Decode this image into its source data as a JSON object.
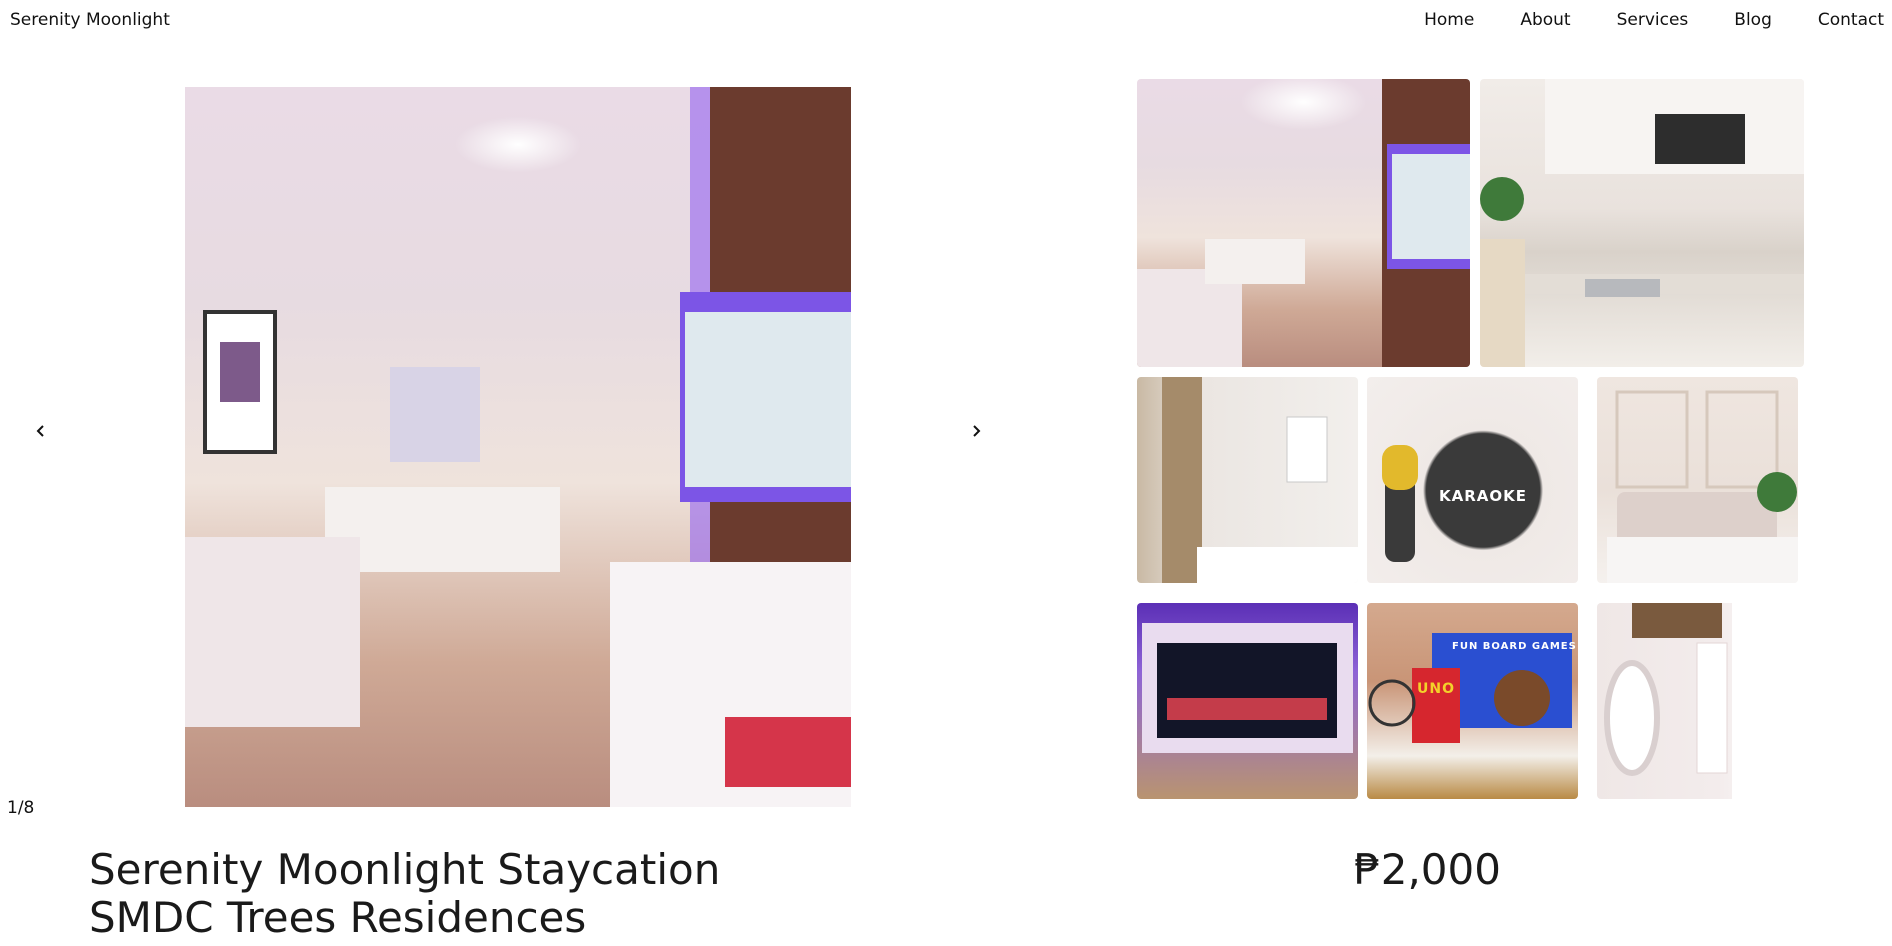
{
  "header": {
    "brand": "Serenity Moonlight",
    "nav": [
      "Home",
      "About",
      "Services",
      "Blog",
      "Contact"
    ]
  },
  "carousel": {
    "counter": "1/8",
    "prev_icon": "chevron-left-icon",
    "next_icon": "chevron-right-icon"
  },
  "gallery": {
    "karaoke_text": "KARAOKE",
    "games_text": "FUN BOARD GAMES",
    "uno_text": "UNO"
  },
  "listing": {
    "title_line1": "Serenity Moonlight Staycation",
    "title_line2": "SMDC Trees Residences",
    "price": "₱2,000"
  },
  "colors": {
    "accent_purple": "#7b3fe4",
    "text": "#1a1a1a"
  }
}
